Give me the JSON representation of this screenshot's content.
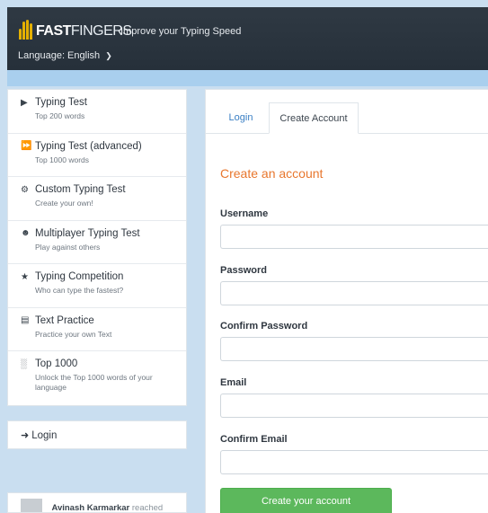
{
  "header": {
    "brand_bold": "FAST",
    "brand_light": "FINGERS",
    "tagline": "Improve your Typing Speed",
    "language_label": "Language: English"
  },
  "sidebar": {
    "items": [
      {
        "icon": "play-icon",
        "title": "Typing Test",
        "subtitle": "Top 200 words"
      },
      {
        "icon": "fast-forward-icon",
        "title": "Typing Test (advanced)",
        "subtitle": "Top 1000 words"
      },
      {
        "icon": "cogs-icon",
        "title": "Custom Typing Test",
        "subtitle": "Create your own!"
      },
      {
        "icon": "users-icon",
        "title": "Multiplayer Typing Test",
        "subtitle": "Play against others"
      },
      {
        "icon": "trophy-icon",
        "title": "Typing Competition",
        "subtitle": "Who can type the fastest?"
      },
      {
        "icon": "document-icon",
        "title": "Text Practice",
        "subtitle": "Practice your own Text"
      },
      {
        "icon": "signal-icon",
        "title": "Top 1000",
        "subtitle": "Unlock the Top 1000 words of your language"
      }
    ],
    "login_label": "Login",
    "activity": {
      "name": "Avinash Karmarkar",
      "text": "reached"
    }
  },
  "tabs": {
    "login": "Login",
    "create": "Create Account"
  },
  "form": {
    "title": "Create an account",
    "username_label": "Username",
    "password_label": "Password",
    "confirm_password_label": "Confirm Password",
    "email_label": "Email",
    "confirm_email_label": "Confirm Email",
    "submit_label": "Create your account"
  },
  "colors": {
    "accent": "#e8772e",
    "button": "#5cb85c",
    "link": "#3a7fc4",
    "header": "#2f3943"
  }
}
